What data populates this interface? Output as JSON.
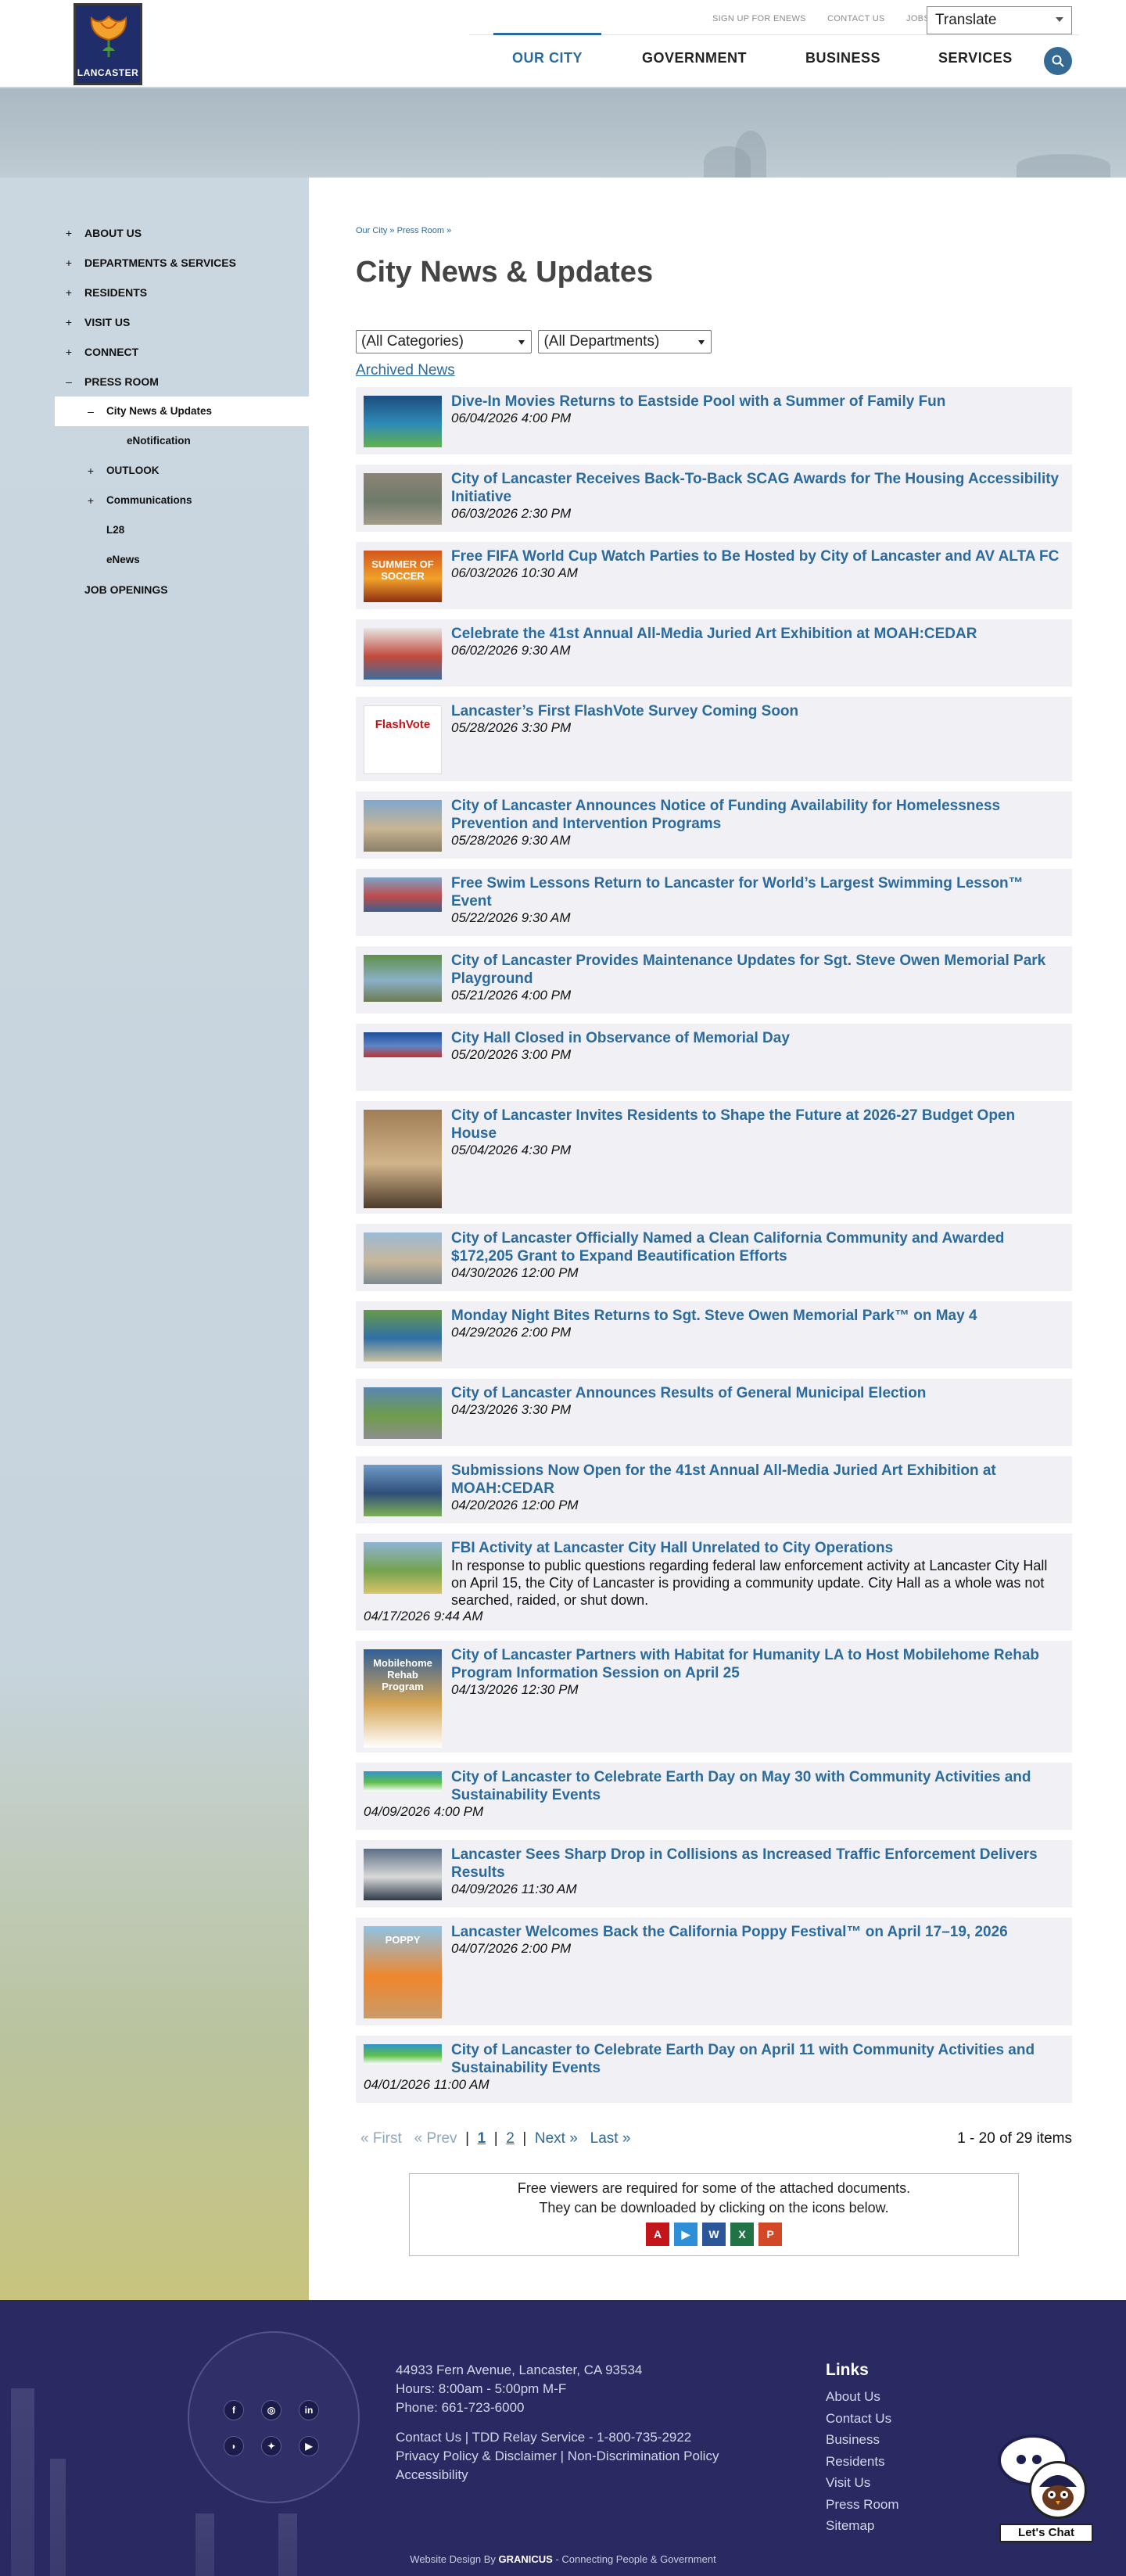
{
  "logo": {
    "text": "LANCASTER"
  },
  "utility": {
    "links": [
      "SIGN UP FOR ENEWS",
      "CONTACT US",
      "JOBS"
    ],
    "translate_label": "Translate"
  },
  "nav": {
    "items": [
      "OUR CITY",
      "GOVERNMENT",
      "BUSINESS",
      "SERVICES"
    ],
    "active": "OUR CITY"
  },
  "sidebar": {
    "items": [
      {
        "label": "ABOUT US",
        "marker": "+",
        "level": 0
      },
      {
        "label": "DEPARTMENTS & SERVICES",
        "marker": "+",
        "level": 0
      },
      {
        "label": "RESIDENTS",
        "marker": "+",
        "level": 0
      },
      {
        "label": "VISIT US",
        "marker": "+",
        "level": 0
      },
      {
        "label": "CONNECT",
        "marker": "+",
        "level": 0
      },
      {
        "label": "PRESS ROOM",
        "marker": "–",
        "level": 0
      },
      {
        "label": "City News & Updates",
        "marker": "–",
        "level": 1,
        "current": true
      },
      {
        "label": "eNotification",
        "marker": "",
        "level": 2
      },
      {
        "label": "OUTLOOK",
        "marker": "+",
        "level": 1
      },
      {
        "label": "Communications",
        "marker": "+",
        "level": 1
      },
      {
        "label": "L28",
        "marker": "",
        "level": 1
      },
      {
        "label": "eNews",
        "marker": "",
        "level": 1
      },
      {
        "label": "JOB OPENINGS",
        "marker": "",
        "level": 0
      }
    ]
  },
  "breadcrumb": "Our City » Press Room »",
  "page_title": "City News & Updates",
  "filters": {
    "category": "(All Categories)",
    "department": "(All Departments)"
  },
  "archived_link": "Archived News",
  "news": [
    {
      "title": "Dive-In Movies Returns to Eastside Pool with a Summer of Family Fun",
      "date": "06/04/2026 4:00 PM",
      "thumb_h": 66,
      "thumb_style": "movie",
      "h": 86
    },
    {
      "title": "City of Lancaster Receives Back-To-Back SCAG Awards for The Housing Accessibility Initiative",
      "date": "06/03/2026 2:30 PM",
      "thumb_h": 66,
      "thumb_style": "aerial",
      "h": 86
    },
    {
      "title": "Free FIFA World Cup Watch Parties to Be Hosted by City of Lancaster and AV ALTA FC",
      "date": "06/03/2026 10:30 AM",
      "thumb_h": 66,
      "thumb_style": "soccer",
      "thumb_text": "SUMMER OF SOCCER",
      "h": 86
    },
    {
      "title": "Celebrate the 41st Annual All-Media Juried Art Exhibition at MOAH:CEDAR",
      "date": "06/02/2026 9:30 AM",
      "thumb_h": 66,
      "thumb_style": "gallery",
      "h": 86
    },
    {
      "title": "Lancaster’s First FlashVote Survey Coming Soon",
      "date": "05/28/2026 3:30 PM",
      "thumb_h": 88,
      "thumb_style": "flashvote",
      "thumb_text": "FlashVote",
      "h": 108
    },
    {
      "title": "City of Lancaster Announces Notice of Funding Availability for Homelessness Prevention and Intervention Programs",
      "date": "05/28/2026 9:30 AM",
      "thumb_h": 66,
      "thumb_style": "sky",
      "h": 86
    },
    {
      "title": "Free Swim Lessons Return to Lancaster for World’s Largest Swimming Lesson™ Event",
      "date": "05/22/2026 9:30 AM",
      "thumb_h": 44,
      "thumb_style": "crowd",
      "h": 86
    },
    {
      "title": "City of Lancaster Provides Maintenance Updates for Sgt. Steve Owen Memorial Park Playground",
      "date": "05/21/2026 4:00 PM",
      "thumb_h": 60,
      "thumb_style": "pond",
      "h": 86
    },
    {
      "title": "City Hall Closed in Observance of Memorial Day",
      "date": "05/20/2026 3:00 PM",
      "thumb_h": 32,
      "thumb_style": "flag",
      "h": 86
    },
    {
      "title": "City of Lancaster Invites Residents to Shape the Future at 2026-27 Budget Open House",
      "date": "05/04/2026 4:30 PM",
      "thumb_h": 126,
      "thumb_style": "interior",
      "h": 144
    },
    {
      "title": "City of Lancaster Officially Named a Clean California Community and Awarded $172,205 Grant to Expand Beautification Efforts",
      "date": "04/30/2026 12:00 PM",
      "thumb_h": 66,
      "thumb_style": "street",
      "h": 86
    },
    {
      "title": "Monday Night Bites Returns to Sgt. Steve Owen Memorial Park™ on May 4",
      "date": "04/29/2026 2:00 PM",
      "thumb_h": 66,
      "thumb_style": "park",
      "h": 86
    },
    {
      "title": "City of Lancaster Announces Results of General Municipal Election",
      "date": "04/23/2026 3:30 PM",
      "thumb_h": 66,
      "thumb_style": "building",
      "h": 86
    },
    {
      "title": "Submissions Now Open for the 41st Annual All-Media Juried Art Exhibition at MOAH:CEDAR",
      "date": "04/20/2026 12:00 PM",
      "thumb_h": 66,
      "thumb_style": "museum",
      "h": 86
    },
    {
      "title": "FBI Activity at Lancaster City Hall Unrelated to City Operations",
      "description": "In response to public questions regarding federal law enforcement activity at Lancaster City Hall on April 15, the City of Lancaster is providing a community update. City Hall as a whole was not searched, raided, or shut down.",
      "date": "04/17/2026 9:44 AM",
      "thumb_h": 66,
      "thumb_style": "cityhall",
      "h": 124
    },
    {
      "title": "City of Lancaster Partners with Habitat for Humanity LA to Host Mobilehome Rehab Program Information Session on April 25",
      "date": "04/13/2026 12:30 PM",
      "thumb_h": 126,
      "thumb_style": "flyer",
      "thumb_text": "Mobilehome Rehab Program",
      "h": 143
    },
    {
      "title": "City of Lancaster to Celebrate Earth Day on May 30 with Community Activities and Sustainability Events",
      "date": "04/09/2026 4:00 PM",
      "thumb_h": 26,
      "thumb_style": "earth",
      "h": 86
    },
    {
      "title": "Lancaster Sees Sharp Drop in Collisions as Increased Traffic Enforcement Delivers Results",
      "date": "04/09/2026 11:30 AM",
      "thumb_h": 66,
      "thumb_style": "motor",
      "h": 86
    },
    {
      "title": "Lancaster Welcomes Back the California Poppy Festival™ on April 17–19, 2026",
      "date": "04/07/2026 2:00 PM",
      "thumb_h": 118,
      "thumb_style": "poppy",
      "thumb_text": "POPPY",
      "h": 138
    },
    {
      "title": "City of Lancaster to Celebrate Earth Day on April 11 with Community Activities and Sustainability Events",
      "date": "04/01/2026 11:00 AM",
      "thumb_h": 26,
      "thumb_style": "earth",
      "h": 86
    }
  ],
  "pager": {
    "first": "« First",
    "prev": "« Prev",
    "sep": "|",
    "pages": [
      "1",
      "2"
    ],
    "next": "Next »",
    "last": "Last »",
    "summary": "1 - 20 of 29 items"
  },
  "viewers": {
    "line1": "Free viewers are required for some of the attached documents.",
    "line2": "They can be downloaded by clicking on the icons below.",
    "icons": [
      {
        "name": "acrobat-reader-icon",
        "color": "#c4151b",
        "glyph": "A"
      },
      {
        "name": "media-player-icon",
        "color": "#2d8fd8",
        "glyph": "▶"
      },
      {
        "name": "word-viewer-icon",
        "color": "#2b579a",
        "glyph": "W"
      },
      {
        "name": "excel-viewer-icon",
        "color": "#217346",
        "glyph": "X"
      },
      {
        "name": "powerpoint-viewer-icon",
        "color": "#d24726",
        "glyph": "P"
      }
    ]
  },
  "footer": {
    "address": "44933 Fern Avenue, Lancaster, CA 93534",
    "hours": "Hours: 8:00am - 5:00pm M-F",
    "phone": "Phone: 661-723-6000",
    "line_contact": "Contact Us | TDD Relay Service - 1-800-735-2922",
    "line_privacy": "Privacy Policy & Disclaimer | Non-Discrimination Policy",
    "line_access": "Accessibility",
    "links_heading": "Links",
    "links": [
      "About Us",
      "Contact Us",
      "Business",
      "Residents",
      "Visit Us",
      "Press Room",
      "Sitemap"
    ],
    "social": [
      {
        "name": "facebook-icon",
        "glyph": "f"
      },
      {
        "name": "instagram-icon",
        "glyph": "◎"
      },
      {
        "name": "linkedin-icon",
        "glyph": "in"
      },
      {
        "name": "rss-icon",
        "glyph": "◗"
      },
      {
        "name": "twitter-icon",
        "glyph": "✦"
      },
      {
        "name": "youtube-icon",
        "glyph": "▶"
      }
    ],
    "credit_prefix": "Website Design By",
    "credit_brand": "GRANICUS",
    "credit_suffix": "- Connecting People & Government",
    "chat_label": "Let's Chat"
  }
}
